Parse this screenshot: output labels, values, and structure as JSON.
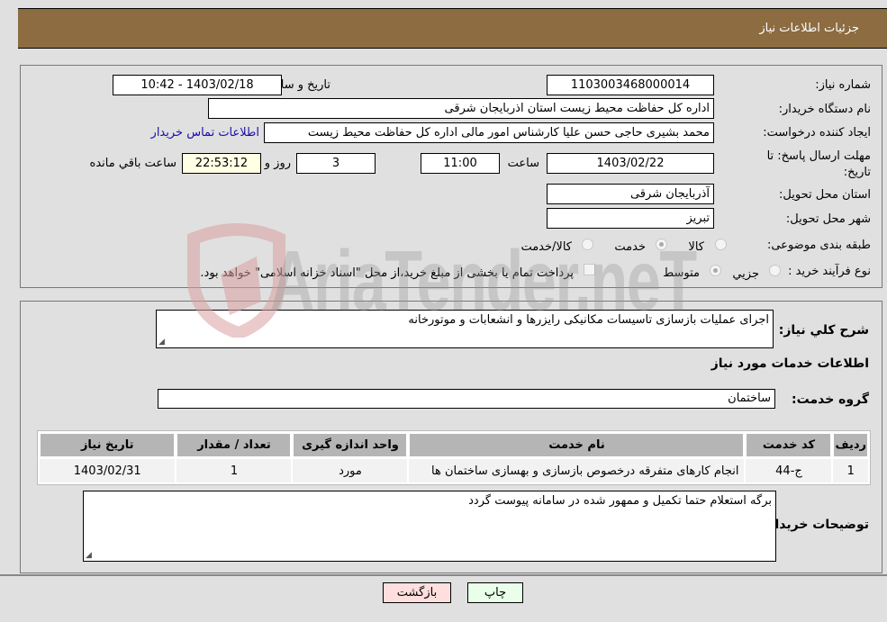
{
  "header": {
    "title": "جزئیات اطلاعات نیاز"
  },
  "form": {
    "need_number_label": "شماره نیاز:",
    "need_number": "1103003468000014",
    "announce_label": "تاريخ و ساعت اعلان عمومي:",
    "announce_value": "1403/02/18 - 10:42",
    "buyer_org_label": "نام دستگاه خريدار:",
    "buyer_org": "اداره کل حفاظت محیط زیست استان اذربایجان شرقی",
    "creator_label": "ايجاد کننده درخواست:",
    "creator": "محمد بشیری حاجی حسن علیا کارشناس امور مالی اداره کل حفاظت محیط زیست",
    "contact_link": "اطلاعات تماس خريدار",
    "deadline_label": "مهلت ارسال پاسخ: تا تاریخ:",
    "deadline_date": "1403/02/22",
    "time_label": "ساعت",
    "deadline_time": "11:00",
    "days_value": "3",
    "days_label": "روز و",
    "remaining_value": "22:53:12",
    "remaining_label": "ساعت باقي مانده",
    "province_label": "استان محل تحویل:",
    "province": "آذربایجان شرقی",
    "city_label": "شهر محل تحویل:",
    "city": "تبریز",
    "category_label": "طبقه بندی موضوعی:",
    "category_options": [
      {
        "label": "کالا",
        "selected": false
      },
      {
        "label": "خدمت",
        "selected": true
      },
      {
        "label": "کالا/خدمت",
        "selected": false
      }
    ],
    "process_label": "نوع فرآیند خرید :",
    "process_options": [
      {
        "label": "جزيي",
        "selected": false
      },
      {
        "label": "متوسط",
        "selected": true
      }
    ],
    "treasury_checkbox_label": "پرداخت تمام یا بخشی از مبلغ خرید،از محل \"اسناد خزانه اسلامی\" خواهد بود.",
    "treasury_checked": false
  },
  "details": {
    "summary_label": "شرح کلي نياز:",
    "summary": "اجرای عملیات بازسازی تاسیسات مکانیکی رایزرها و انشعابات و موتورخانه",
    "services_heading": "اطلاعات خدمات مورد نیاز",
    "service_group_label": "گروه خدمت:",
    "service_group": "ساختمان",
    "table": {
      "headers": [
        "رديف",
        "کد خدمت",
        "نام خدمت",
        "واحد اندازه گيری",
        "تعداد / مقدار",
        "تاريخ نياز"
      ],
      "rows": [
        [
          "1",
          "ج-44",
          "انجام کارهای متفرقه درخصوص بازسازی و بهسازی ساختمان ها",
          "مورد",
          "1",
          "1403/02/31"
        ]
      ]
    },
    "buyer_notes_label": "توضيحات خريدار:",
    "buyer_notes": "برگه استعلام حتما تکمیل و ممهور شده در سامانه پیوست گردد"
  },
  "buttons": {
    "print": "چاپ",
    "back": "بازگشت"
  },
  "watermark": "AriaTender.neT",
  "colors": {
    "header_bg": "#8c6c40",
    "print_bg": "#eaffea",
    "back_bg": "#ffdede",
    "link": "#1a0dab"
  }
}
